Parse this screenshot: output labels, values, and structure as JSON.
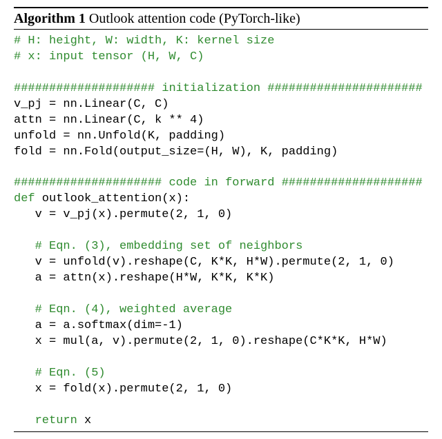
{
  "title": {
    "label": "Algorithm 1",
    "caption": "Outlook attention code (PyTorch-like)"
  },
  "code": {
    "c_dims": "# H: height, W: width, K: kernel size",
    "c_input": "# x: input tensor (H, W, C)",
    "c_init_hashes_l": "####################",
    "c_init_label": " initialization ",
    "c_init_hashes_r": "######################",
    "l_vpj": "v_pj = nn.Linear(C, C)",
    "l_attn": "attn = nn.Linear(C, k ** 4)",
    "l_unfold": "unfold = nn.Unfold(K, padding)",
    "l_fold": "fold = nn.Fold(output_size=(H, W), K, padding)",
    "c_fwd_hashes_l": "#####################",
    "c_fwd_label": " code in forward ",
    "c_fwd_hashes_r": "####################",
    "kw_def": "def",
    "l_defname": " outlook_attention(x):",
    "l_v1": "   v = v_pj(x).permute(2, 1, 0)",
    "c_eqn3": "   # Eqn. (3), embedding set of neighbors",
    "l_v2": "   v = unfold(v).reshape(C, K*K, H*W).permute(2, 1, 0)",
    "l_a1": "   a = attn(x).reshape(H*W, K*K, K*K)",
    "c_eqn4": "   # Eqn. (4), weighted average",
    "l_a2": "   a = a.softmax(dim=-1)",
    "l_x1": "   x = mul(a, v).permute(2, 1, 0).reshape(C*K*K, H*W)",
    "c_eqn5": "   # Eqn. (5)",
    "l_x2": "   x = fold(x).permute(2, 1, 0)",
    "kw_ret": "return",
    "l_retpad": "   ",
    "l_retx": " x"
  }
}
